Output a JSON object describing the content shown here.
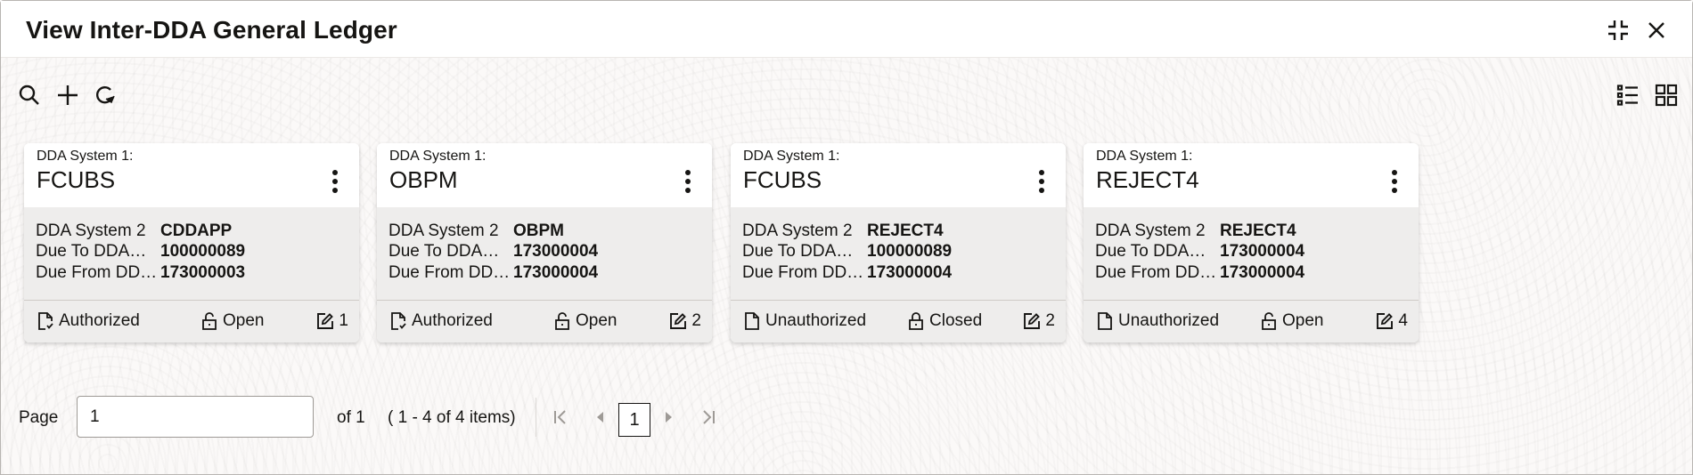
{
  "header": {
    "title": "View Inter-DDA General Ledger",
    "icons": [
      "minimize-icon",
      "close-icon"
    ]
  },
  "toolbar": {
    "left_icons": [
      "search-icon",
      "add-icon",
      "refresh-icon"
    ],
    "right_icons": [
      "list-view-icon",
      "grid-view-icon"
    ]
  },
  "cards": [
    {
      "caption": "DDA System 1:",
      "title": "FCUBS",
      "rows": [
        {
          "label": "DDA System 2",
          "value": "CDDAPP"
        },
        {
          "label": "Due To DDA…",
          "value": "100000089"
        },
        {
          "label": "Due From DD…",
          "value": "173000003"
        }
      ],
      "auth_status": "Authorized",
      "record_status": "Open",
      "mod_count": "1"
    },
    {
      "caption": "DDA System 1:",
      "title": "OBPM",
      "rows": [
        {
          "label": "DDA System 2",
          "value": "OBPM"
        },
        {
          "label": "Due To DDA…",
          "value": "173000004"
        },
        {
          "label": "Due From DD…",
          "value": "173000004"
        }
      ],
      "auth_status": "Authorized",
      "record_status": "Open",
      "mod_count": "2"
    },
    {
      "caption": "DDA System 1:",
      "title": "FCUBS",
      "rows": [
        {
          "label": "DDA System 2",
          "value": "REJECT4"
        },
        {
          "label": "Due To DDA…",
          "value": "100000089"
        },
        {
          "label": "Due From DD…",
          "value": "173000004"
        }
      ],
      "auth_status": "Unauthorized",
      "record_status": "Closed",
      "mod_count": "2"
    },
    {
      "caption": "DDA System 1:",
      "title": "REJECT4",
      "rows": [
        {
          "label": "DDA System 2",
          "value": "REJECT4"
        },
        {
          "label": "Due To DDA…",
          "value": "173000004"
        },
        {
          "label": "Due From DD…",
          "value": "173000004"
        }
      ],
      "auth_status": "Unauthorized",
      "record_status": "Open",
      "mod_count": "4"
    }
  ],
  "pagination": {
    "page_label": "Page",
    "page_value": "1",
    "of_label": "of 1",
    "range_label": "( 1 - 4 of 4 items)",
    "current_page": "1"
  }
}
